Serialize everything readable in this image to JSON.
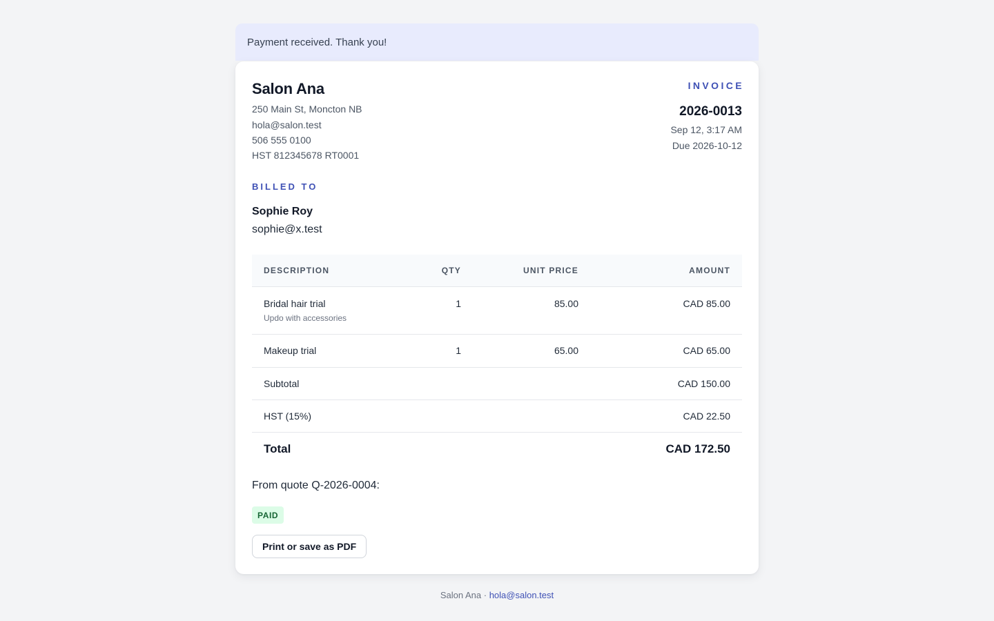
{
  "banner": {
    "message": "Payment received. Thank you!"
  },
  "business": {
    "name": "Salon Ana",
    "address": "250 Main St, Moncton NB",
    "email": "hola@salon.test",
    "phone": "506 555 0100",
    "tax_id": "HST 812345678 RT0001"
  },
  "invoice": {
    "label": "INVOICE",
    "number": "2026-0013",
    "date": "Sep 12, 3:17 AM",
    "due": "Due 2026-10-12"
  },
  "billed_to": {
    "label": "BILLED TO",
    "name": "Sophie Roy",
    "email": "sophie@x.test"
  },
  "table": {
    "headers": {
      "description": "DESCRIPTION",
      "qty": "QTY",
      "unit_price": "UNIT PRICE",
      "amount": "AMOUNT"
    },
    "items": [
      {
        "name": "Bridal hair trial",
        "detail": "Updo with accessories",
        "qty": "1",
        "unit_price": "85.00",
        "amount": "CAD 85.00"
      },
      {
        "name": "Makeup trial",
        "qty": "1",
        "unit_price": "65.00",
        "amount": "CAD 65.00"
      }
    ],
    "subtotal": {
      "label": "Subtotal",
      "value": "CAD 150.00"
    },
    "tax": {
      "label": "HST (15%)",
      "value": "CAD 22.50"
    },
    "total": {
      "label": "Total",
      "value": "CAD 172.50"
    }
  },
  "quote_note": "From quote Q-2026-0004:",
  "status_badge": "PAID",
  "print_button": "Print or save as PDF",
  "footer": {
    "name": "Salon Ana",
    "separator": " · ",
    "email": "hola@salon.test"
  },
  "colors": {
    "accent": "#3f51b5",
    "banner_bg": "#e8ebfd",
    "paid_bg": "#dcfce7",
    "paid_text": "#166534",
    "page_bg": "#f3f4f6"
  }
}
